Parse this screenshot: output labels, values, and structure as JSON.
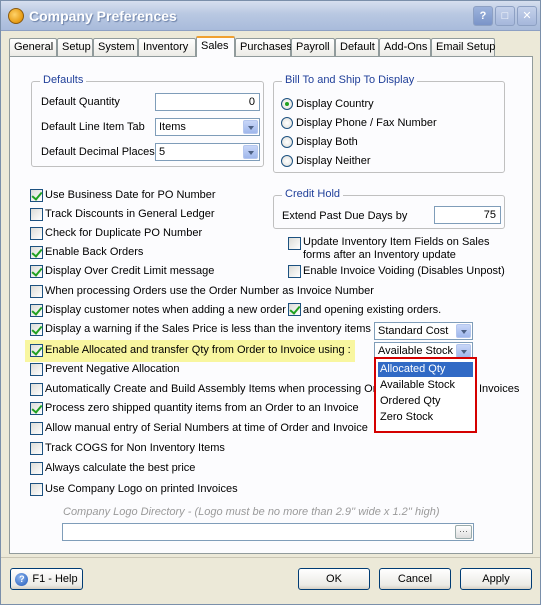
{
  "window": {
    "title": "Company Preferences"
  },
  "tabs": [
    {
      "label": "General"
    },
    {
      "label": "Setup"
    },
    {
      "label": "System"
    },
    {
      "label": "Inventory"
    },
    {
      "label": "Sales"
    },
    {
      "label": "Purchases"
    },
    {
      "label": "Payroll"
    },
    {
      "label": "Default"
    },
    {
      "label": "Add-Ons"
    },
    {
      "label": "Email Setup"
    }
  ],
  "active_tab": "Sales",
  "defaults": {
    "title": "Defaults",
    "quantity_label": "Default Quantity",
    "quantity_value": "0",
    "line_item_tab_label": "Default Line Item Tab",
    "line_item_tab_value": "Items",
    "decimal_places_label": "Default Decimal Places",
    "decimal_places_value": "5"
  },
  "bill_ship": {
    "title": "Bill To and Ship To Display",
    "options": [
      {
        "label": "Display Country",
        "selected": true
      },
      {
        "label": "Display Phone / Fax Number",
        "selected": false
      },
      {
        "label": "Display Both",
        "selected": false
      },
      {
        "label": "Display Neither",
        "selected": false
      }
    ]
  },
  "credit_hold": {
    "title": "Credit Hold",
    "label": "Extend Past Due Days by",
    "value": "75"
  },
  "checks": {
    "business_date": {
      "label": "Use Business Date for PO Number",
      "checked": true
    },
    "track_discounts": {
      "label": "Track Discounts in General Ledger",
      "checked": false
    },
    "duplicate_po": {
      "label": "Check for Duplicate PO Number",
      "checked": false
    },
    "back_orders": {
      "label": "Enable Back Orders",
      "checked": true
    },
    "over_credit": {
      "label": "Display Over Credit Limit message",
      "checked": true
    },
    "order_number": {
      "label": "When processing Orders use the Order Number as Invoice Number",
      "checked": false
    },
    "customer_notes": {
      "label": "Display customer notes when adding a new order",
      "checked": true
    },
    "opening_orders": {
      "label": "and opening existing orders.",
      "checked": true
    },
    "sales_price_warning": {
      "label": "Display a warning if the Sales Price is less than the inventory items",
      "checked": true
    },
    "allocated_transfer": {
      "label": "Enable Allocated and transfer Qty from Order to Invoice using :",
      "checked": true
    },
    "negative_allocation": {
      "label": "Prevent Negative Allocation",
      "checked": false
    },
    "assembly_items": {
      "label": "Automatically Create and Build Assembly Items when processing Ord",
      "suffix": "Invoices",
      "checked": false
    },
    "zero_shipped": {
      "label": "Process zero shipped quantity items from an Order to an Invoice",
      "checked": true
    },
    "serial_numbers": {
      "label": "Allow manual entry of Serial Numbers at time of Order and Invoice",
      "checked": false
    },
    "track_cogs": {
      "label": "Track COGS for Non Inventory Items",
      "checked": false
    },
    "best_price": {
      "label": "Always calculate the best price",
      "checked": false
    },
    "company_logo": {
      "label": "Use Company Logo on printed Invoices",
      "checked": false
    },
    "update_inventory": {
      "label": "Update Inventory Item Fields on Sales",
      "label2": "forms after an Inventory update",
      "checked": false
    },
    "invoice_voiding": {
      "label": "Enable Invoice Voiding (Disables Unpost)",
      "checked": false
    }
  },
  "sales_price_combo": {
    "value": "Standard Cost"
  },
  "allocated_combo": {
    "value": "Available Stock",
    "options": [
      {
        "label": "Allocated Qty",
        "selected": true
      },
      {
        "label": "Available Stock",
        "selected": false
      },
      {
        "label": "Ordered Qty",
        "selected": false
      },
      {
        "label": "Zero Stock",
        "selected": false
      }
    ]
  },
  "logo_directory": {
    "label": "Company Logo Directory - (Logo must be no more than 2.9'' wide x 1.2'' high)",
    "value": ""
  },
  "buttons": {
    "help": "F1 - Help",
    "ok": "OK",
    "cancel": "Cancel",
    "apply": "Apply"
  },
  "colors": {
    "highlight": "#f8f6a0",
    "group_title": "#21409a",
    "dropdown_border": "#d40000",
    "selection": "#316ac5"
  }
}
